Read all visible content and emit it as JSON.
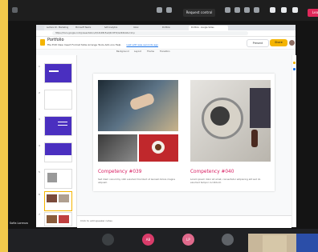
{
  "meet": {
    "request_label": "Request control",
    "leave_label": "Leave",
    "presenter_name": "Sofia Lorenzo",
    "participants": [
      {
        "initials": "",
        "color": "#3c4043"
      },
      {
        "initials": "AB",
        "color": "#d93c6a"
      },
      {
        "initials": "LP",
        "color": "#e06a8c"
      },
      {
        "initials": "",
        "color": "#5f6368"
      }
    ]
  },
  "browser": {
    "tabs": [
      "Lecture 10 - Marketing",
      "Microsoft Teams",
      "SAP Analytics",
      "Inbox",
      "Portfolio",
      "Portfolio - Google Slides"
    ],
    "url": "https://docs.google.com/presentation/d/1ZxR8c5wQ4mt3T2/edit#slide=id.p"
  },
  "doc": {
    "title": "Portfolio",
    "menu": "File  Edit  View  Insert  Format  Slide  Arrange  Tools  Add-ons  Help",
    "last_edit": "Last edit was seconds ago",
    "present_label": "Present",
    "share_label": "Share",
    "toolbar": [
      "Background",
      "Layout",
      "Theme",
      "Transition"
    ]
  },
  "thumbnails": [
    {
      "num": "1",
      "style": "purple-title"
    },
    {
      "num": "2",
      "style": "white"
    },
    {
      "num": "3",
      "style": "purple-lines"
    },
    {
      "num": "4",
      "style": "purple-block"
    },
    {
      "num": "5",
      "style": "white-image"
    },
    {
      "num": "6",
      "style": "photo-grid"
    },
    {
      "num": "7",
      "style": "photo-grid"
    }
  ],
  "slide": {
    "left": {
      "title": "Competency #039",
      "description": "Sed diam nonummy nibh euismod tincidunt ut laoreet dolore magna aliquam."
    },
    "right": {
      "title": "Competency #040",
      "description": "Lorem ipsum dolor sit amet, consectetur adipiscing elit sed do eiusmod tempor incididunt."
    }
  },
  "notes_placeholder": "Click to add speaker notes",
  "colors": {
    "accent": "#d81b60",
    "slides_yellow": "#f4b400",
    "leave_red": "#e0285a"
  }
}
